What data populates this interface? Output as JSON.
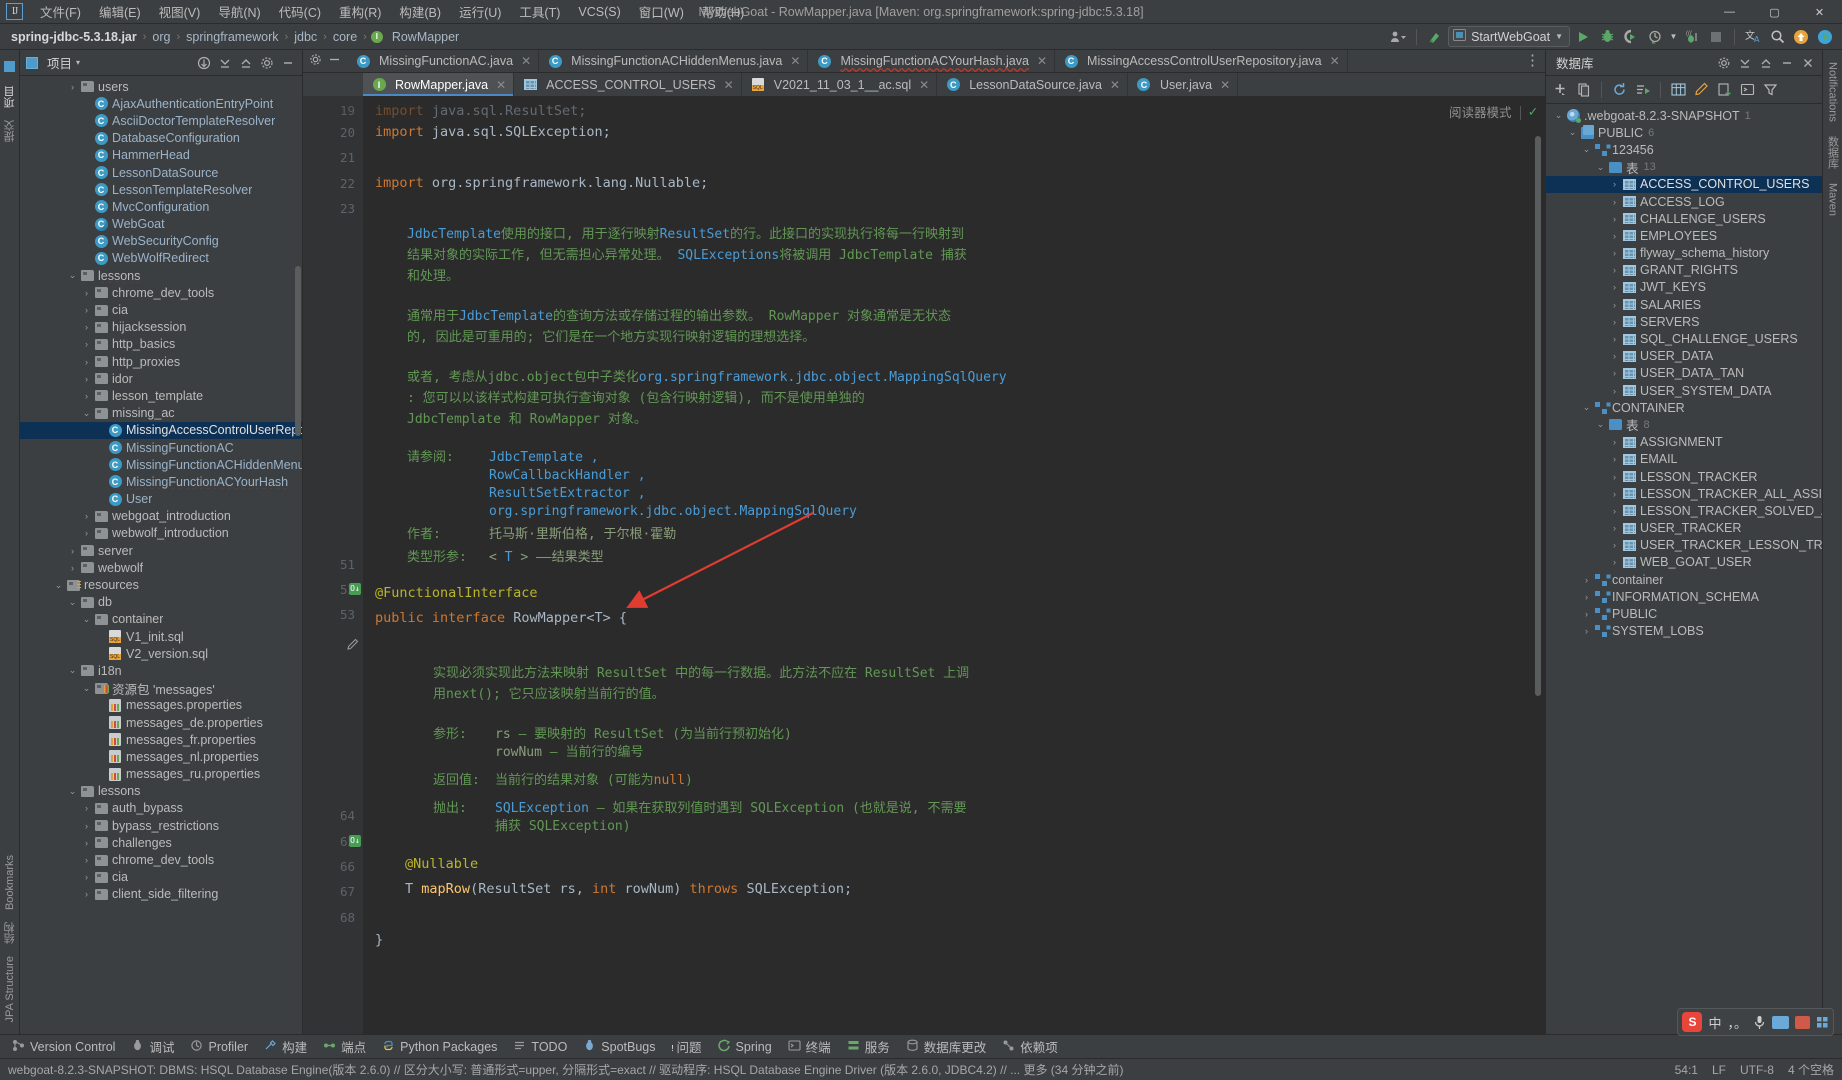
{
  "window": {
    "title": "MyWebGoat - RowMapper.java [Maven: org.springframework:spring-jdbc:5.3.18]",
    "minimize": "—",
    "maximize": "▢",
    "close": "✕"
  },
  "menu": {
    "items": [
      {
        "label": "文件(F)"
      },
      {
        "label": "编辑(E)"
      },
      {
        "label": "视图(V)"
      },
      {
        "label": "导航(N)"
      },
      {
        "label": "代码(C)"
      },
      {
        "label": "重构(R)"
      },
      {
        "label": "构建(B)"
      },
      {
        "label": "运行(U)"
      },
      {
        "label": "工具(T)"
      },
      {
        "label": "VCS(S)"
      },
      {
        "label": "窗口(W)"
      },
      {
        "label": "帮助(H)"
      }
    ]
  },
  "navbar": {
    "breadcrumbs": [
      {
        "label": "spring-jdbc-5.3.18.jar"
      },
      {
        "label": "org"
      },
      {
        "label": "springframework"
      },
      {
        "label": "jdbc"
      },
      {
        "label": "core"
      },
      {
        "label": "RowMapper"
      }
    ],
    "separator": "›",
    "run_config": "StartWebGoat",
    "icons": {
      "user": "user-dropdown-icon",
      "update": "update-project-icon",
      "run": "run-icon",
      "debug": "debug-icon",
      "run_coverage": "run-with-coverage-icon",
      "profile": "profiler-icon",
      "build": "build-icon",
      "stop": "stop-icon",
      "translate": "translate-icon",
      "search": "search-everywhere-icon",
      "updates": "updates-badge-icon",
      "play_badge": "play-badge-icon"
    }
  },
  "left_strip": {
    "tabs": [
      {
        "label": "项目"
      },
      {
        "label": "提交"
      },
      {
        "label": "结构"
      },
      {
        "label": "Bookmarks"
      },
      {
        "label": "JPA Structure"
      }
    ]
  },
  "right_strip": {
    "tabs": [
      {
        "label": "Notifications"
      },
      {
        "label": "数据库"
      },
      {
        "label": "Maven"
      }
    ]
  },
  "project_panel": {
    "title": "项目",
    "dropdown": "▾",
    "actions": [
      "collapse-all-icon",
      "expand-all-icon",
      "select-opened-file-icon",
      "settings-icon",
      "hide-icon"
    ],
    "tree": [
      {
        "depth": 3,
        "arrow": "›",
        "icon": "folder",
        "label": "users",
        "type": "folder"
      },
      {
        "depth": 4,
        "arrow": "",
        "icon": "class",
        "label": "AjaxAuthenticationEntryPoint",
        "type": "class"
      },
      {
        "depth": 4,
        "arrow": "",
        "icon": "class",
        "label": "AsciiDoctorTemplateResolver",
        "type": "class"
      },
      {
        "depth": 4,
        "arrow": "",
        "icon": "class",
        "label": "DatabaseConfiguration",
        "type": "class"
      },
      {
        "depth": 4,
        "arrow": "",
        "icon": "class",
        "label": "HammerHead",
        "type": "class"
      },
      {
        "depth": 4,
        "arrow": "",
        "icon": "class",
        "label": "LessonDataSource",
        "type": "class"
      },
      {
        "depth": 4,
        "arrow": "",
        "icon": "class",
        "label": "LessonTemplateResolver",
        "type": "class"
      },
      {
        "depth": 4,
        "arrow": "",
        "icon": "class",
        "label": "MvcConfiguration",
        "type": "class"
      },
      {
        "depth": 4,
        "arrow": "",
        "icon": "class-spring",
        "label": "WebGoat",
        "type": "class"
      },
      {
        "depth": 4,
        "arrow": "",
        "icon": "class",
        "label": "WebSecurityConfig",
        "type": "class"
      },
      {
        "depth": 4,
        "arrow": "",
        "icon": "class",
        "label": "WebWolfRedirect",
        "type": "class"
      },
      {
        "depth": 3,
        "arrow": "⌄",
        "icon": "folder",
        "label": "lessons",
        "type": "folder",
        "squiggle": true
      },
      {
        "depth": 4,
        "arrow": "›",
        "icon": "folder",
        "label": "chrome_dev_tools",
        "type": "folder"
      },
      {
        "depth": 4,
        "arrow": "›",
        "icon": "folder",
        "label": "cia",
        "type": "folder"
      },
      {
        "depth": 4,
        "arrow": "›",
        "icon": "folder",
        "label": "hijacksession",
        "type": "folder"
      },
      {
        "depth": 4,
        "arrow": "›",
        "icon": "folder",
        "label": "http_basics",
        "type": "folder"
      },
      {
        "depth": 4,
        "arrow": "›",
        "icon": "folder",
        "label": "http_proxies",
        "type": "folder"
      },
      {
        "depth": 4,
        "arrow": "›",
        "icon": "folder",
        "label": "idor",
        "type": "folder"
      },
      {
        "depth": 4,
        "arrow": "›",
        "icon": "folder",
        "label": "lesson_template",
        "type": "folder"
      },
      {
        "depth": 4,
        "arrow": "⌄",
        "icon": "folder",
        "label": "missing_ac",
        "type": "folder",
        "squiggle": true
      },
      {
        "depth": 5,
        "arrow": "",
        "icon": "class",
        "label": "MissingAccessControlUserRepository",
        "type": "class",
        "selected": true
      },
      {
        "depth": 5,
        "arrow": "",
        "icon": "class",
        "label": "MissingFunctionAC",
        "type": "class"
      },
      {
        "depth": 5,
        "arrow": "",
        "icon": "class",
        "label": "MissingFunctionACHiddenMenus",
        "type": "class"
      },
      {
        "depth": 5,
        "arrow": "",
        "icon": "class",
        "label": "MissingFunctionACYourHash",
        "type": "class",
        "squiggle": true
      },
      {
        "depth": 5,
        "arrow": "",
        "icon": "class",
        "label": "User",
        "type": "class"
      },
      {
        "depth": 4,
        "arrow": "›",
        "icon": "folder",
        "label": "webgoat_introduction",
        "type": "folder"
      },
      {
        "depth": 4,
        "arrow": "›",
        "icon": "folder",
        "label": "webwolf_introduction",
        "type": "folder"
      },
      {
        "depth": 3,
        "arrow": "›",
        "icon": "folder",
        "label": "server",
        "type": "folder"
      },
      {
        "depth": 3,
        "arrow": "›",
        "icon": "folder",
        "label": "webwolf",
        "type": "folder"
      },
      {
        "depth": 2,
        "arrow": "⌄",
        "icon": "folder-res",
        "label": "resources",
        "type": "folder"
      },
      {
        "depth": 3,
        "arrow": "⌄",
        "icon": "folder",
        "label": "db",
        "type": "folder"
      },
      {
        "depth": 4,
        "arrow": "⌄",
        "icon": "folder",
        "label": "container",
        "type": "folder"
      },
      {
        "depth": 5,
        "arrow": "",
        "icon": "sql",
        "label": "V1_init.sql",
        "type": "file"
      },
      {
        "depth": 5,
        "arrow": "",
        "icon": "sql",
        "label": "V2_version.sql",
        "type": "file"
      },
      {
        "depth": 3,
        "arrow": "⌄",
        "icon": "folder",
        "label": "i18n",
        "type": "folder"
      },
      {
        "depth": 4,
        "arrow": "⌄",
        "icon": "folder-bundle",
        "label": "资源包 'messages'",
        "type": "folder"
      },
      {
        "depth": 5,
        "arrow": "",
        "icon": "properties",
        "label": "messages.properties",
        "type": "file"
      },
      {
        "depth": 5,
        "arrow": "",
        "icon": "properties",
        "label": "messages_de.properties",
        "type": "file"
      },
      {
        "depth": 5,
        "arrow": "",
        "icon": "properties",
        "label": "messages_fr.properties",
        "type": "file"
      },
      {
        "depth": 5,
        "arrow": "",
        "icon": "properties",
        "label": "messages_nl.properties",
        "type": "file"
      },
      {
        "depth": 5,
        "arrow": "",
        "icon": "properties",
        "label": "messages_ru.properties",
        "type": "file"
      },
      {
        "depth": 3,
        "arrow": "⌄",
        "icon": "folder",
        "label": "lessons",
        "type": "folder"
      },
      {
        "depth": 4,
        "arrow": "›",
        "icon": "folder",
        "label": "auth_bypass",
        "type": "folder"
      },
      {
        "depth": 4,
        "arrow": "›",
        "icon": "folder",
        "label": "bypass_restrictions",
        "type": "folder"
      },
      {
        "depth": 4,
        "arrow": "›",
        "icon": "folder",
        "label": "challenges",
        "type": "folder"
      },
      {
        "depth": 4,
        "arrow": "›",
        "icon": "folder",
        "label": "chrome_dev_tools",
        "type": "folder"
      },
      {
        "depth": 4,
        "arrow": "›",
        "icon": "folder",
        "label": "cia",
        "type": "folder"
      },
      {
        "depth": 4,
        "arrow": "›",
        "icon": "folder",
        "label": "client_side_filtering",
        "type": "folder"
      }
    ]
  },
  "editor": {
    "tabs_row1": [
      {
        "label": "MissingFunctionAC.java",
        "icon": "java-class-icon",
        "active": false
      },
      {
        "label": "MissingFunctionACHiddenMenus.java",
        "icon": "java-class-icon",
        "active": false
      },
      {
        "label": "MissingFunctionACYourHash.java",
        "icon": "java-class-icon",
        "active": false,
        "error": true
      },
      {
        "label": "MissingAccessControlUserRepository.java",
        "icon": "java-class-icon",
        "active": false
      }
    ],
    "tabs_row2": [
      {
        "label": "RowMapper.java",
        "icon": "interface-icon",
        "active": true
      },
      {
        "label": "ACCESS_CONTROL_USERS",
        "icon": "table-icon",
        "active": false
      },
      {
        "label": "V2021_11_03_1__ac.sql",
        "icon": "sql-icon",
        "active": false
      },
      {
        "label": "LessonDataSource.java",
        "icon": "java-class-icon",
        "active": false
      },
      {
        "label": "User.java",
        "icon": "java-class-icon",
        "active": false
      }
    ],
    "reader_mode": "阅读器模式",
    "reader_check": "✓",
    "lines": [
      {
        "num": "19",
        "kind": "code",
        "html": "<span class=\"kw\">import</span> java.sql.ResultSet;",
        "faded": true
      },
      {
        "num": "20",
        "kind": "code",
        "html": "<span class=\"kw\">import</span> java.sql.SQLException;"
      },
      {
        "num": "21",
        "kind": "blank",
        "html": ""
      },
      {
        "num": "22",
        "kind": "code",
        "html": "<span class=\"kw\">import</span> org.springframework.lang.<span style=\"color:#b5b6e3\">Nullable</span>;"
      },
      {
        "num": "23",
        "kind": "blank",
        "html": ""
      }
    ],
    "javadoc": {
      "p1_pre": "JdbcTemplate",
      "p1_mid": "使用的接口, 用于逐行映射",
      "p1_link2": "ResultSet",
      "p1_tail": "的行。此接口的实现执行将每一行映射到",
      "p2": "结果对象的实际工作, 但无需担心异常处理。 ",
      "p2_link": "SQLExceptions",
      "p2_tail": "将被调用 JdbcTemplate 捕获",
      "p3": "和处理。",
      "p4_a": "通常用于",
      "p4_link": "JdbcTemplate",
      "p4_b": "的查询方法或存储过程的输出参数。 RowMapper 对象通常是无状态",
      "p5": "的, 因此是可重用的; 它们是在一个地方实现行映射逻辑的理想选择。",
      "p6_a": "或者, 考虑从jdbc.object包中子类化",
      "p6_link": "org.springframework.jdbc.object.MappingSqlQuery",
      "p7": ": 您可以以该样式构建可执行查询对象 (包含行映射逻辑), 而不是使用单独的",
      "p8": "JdbcTemplate 和 RowMapper 对象。",
      "see_label": "请参阅:",
      "see_items": [
        "JdbcTemplate ,",
        "RowCallbackHandler ,",
        "ResultSetExtractor ,",
        "org.springframework.jdbc.object.MappingSqlQuery"
      ],
      "author_label": "作者:",
      "author_value": "托马斯·里斯伯格, 于尔根·霍勒",
      "typeparam_label": "类型形参:",
      "typeparam_value_pre": "<",
      "typeparam_value_t": "T",
      "typeparam_value_post": "> ——结果类型"
    },
    "code2": {
      "l51_num": "51",
      "l51": "@FunctionalInterface",
      "l52_num": "52",
      "l52_kw1": "public",
      "l52_kw2": "interface",
      "l52_name": "RowMapper",
      "l52_gen": "<T> {",
      "l53_num": "53"
    },
    "javadoc2": {
      "p1": "实现必须实现此方法来映射 ResultSet 中的每一行数据。此方法不应在 ResultSet 上调",
      "p2_a": "用",
      "p2_next": "next()",
      "p2_b": "; 它只应该映射当前行的值。",
      "params_label": "参形:",
      "param1_name": "rs",
      "param1_desc": "– 要映射的 ResultSet (为当前行预初始化)",
      "param2_name": "rowNum",
      "param2_desc": "– 当前行的编号",
      "returns_label": "返回值:",
      "returns_desc_a": "当前行的结果对象 (可能为",
      "returns_null": "null",
      "returns_desc_b": ")",
      "throws_label": "抛出:",
      "throws_type": "SQLException",
      "throws_desc": "– 如果在获取列值时遇到 SQLException (也就是说, 不需要",
      "throws_desc2": "捕获 SQLException)"
    },
    "code3": {
      "l64_num": "64",
      "l64": "@Nullable",
      "l65_num": "65",
      "l65_t": "T",
      "l65_m": "mapRow",
      "l65_p1": "(ResultSet rs, ",
      "l65_kw": "int",
      "l65_p2": " rowNum) ",
      "l65_throws": "throws",
      "l65_ex": " SQLException;",
      "l66_num": "66",
      "l67_num": "67",
      "l67": "}",
      "l68_num": "68"
    }
  },
  "db_panel": {
    "title": "数据库",
    "toolbar": [
      "add-icon",
      "copy-icon",
      "refresh-icon",
      "run-sql-icon",
      "table-icon",
      "edit-icon",
      "new-query-icon",
      "console-icon",
      "filter-icon",
      "settings-icon",
      "collapse-icon",
      "expand-icon",
      "minimize-icon",
      "close-icon"
    ],
    "tree": [
      {
        "depth": 0,
        "arrow": "⌄",
        "icon": "db",
        "label": ".webgoat-8.2.3-SNAPSHOT",
        "badge": "1"
      },
      {
        "depth": 1,
        "arrow": "⌄",
        "icon": "pub",
        "label": "PUBLIC",
        "badge": "6"
      },
      {
        "depth": 2,
        "arrow": "⌄",
        "icon": "schema",
        "label": "123456",
        "badge": ""
      },
      {
        "depth": 3,
        "arrow": "⌄",
        "icon": "fold",
        "label": "表",
        "badge": "13"
      },
      {
        "depth": 4,
        "arrow": "›",
        "icon": "table",
        "label": "ACCESS_CONTROL_USERS",
        "selected": true
      },
      {
        "depth": 4,
        "arrow": "›",
        "icon": "table",
        "label": "ACCESS_LOG"
      },
      {
        "depth": 4,
        "arrow": "›",
        "icon": "table",
        "label": "CHALLENGE_USERS"
      },
      {
        "depth": 4,
        "arrow": "›",
        "icon": "table",
        "label": "EMPLOYEES"
      },
      {
        "depth": 4,
        "arrow": "›",
        "icon": "table",
        "label": "flyway_schema_history"
      },
      {
        "depth": 4,
        "arrow": "›",
        "icon": "table",
        "label": "GRANT_RIGHTS"
      },
      {
        "depth": 4,
        "arrow": "›",
        "icon": "table",
        "label": "JWT_KEYS"
      },
      {
        "depth": 4,
        "arrow": "›",
        "icon": "table",
        "label": "SALARIES"
      },
      {
        "depth": 4,
        "arrow": "›",
        "icon": "table",
        "label": "SERVERS"
      },
      {
        "depth": 4,
        "arrow": "›",
        "icon": "table",
        "label": "SQL_CHALLENGE_USERS"
      },
      {
        "depth": 4,
        "arrow": "›",
        "icon": "table",
        "label": "USER_DATA"
      },
      {
        "depth": 4,
        "arrow": "›",
        "icon": "table",
        "label": "USER_DATA_TAN"
      },
      {
        "depth": 4,
        "arrow": "›",
        "icon": "table",
        "label": "USER_SYSTEM_DATA"
      },
      {
        "depth": 2,
        "arrow": "⌄",
        "icon": "schema",
        "label": "CONTAINER",
        "badge": ""
      },
      {
        "depth": 3,
        "arrow": "⌄",
        "icon": "fold",
        "label": "表",
        "badge": "8"
      },
      {
        "depth": 4,
        "arrow": "›",
        "icon": "table",
        "label": "ASSIGNMENT"
      },
      {
        "depth": 4,
        "arrow": "›",
        "icon": "table",
        "label": "EMAIL"
      },
      {
        "depth": 4,
        "arrow": "›",
        "icon": "table",
        "label": "LESSON_TRACKER"
      },
      {
        "depth": 4,
        "arrow": "›",
        "icon": "table",
        "label": "LESSON_TRACKER_ALL_ASSIGNMENTS"
      },
      {
        "depth": 4,
        "arrow": "›",
        "icon": "table",
        "label": "LESSON_TRACKER_SOLVED_ASSIGNMENTS"
      },
      {
        "depth": 4,
        "arrow": "›",
        "icon": "table",
        "label": "USER_TRACKER"
      },
      {
        "depth": 4,
        "arrow": "›",
        "icon": "table",
        "label": "USER_TRACKER_LESSON_TRACKERS"
      },
      {
        "depth": 4,
        "arrow": "›",
        "icon": "table",
        "label": "WEB_GOAT_USER"
      },
      {
        "depth": 2,
        "arrow": "›",
        "icon": "schema",
        "label": "container",
        "badge": ""
      },
      {
        "depth": 2,
        "arrow": "›",
        "icon": "schema",
        "label": "INFORMATION_SCHEMA",
        "badge": ""
      },
      {
        "depth": 2,
        "arrow": "›",
        "icon": "schema",
        "label": "PUBLIC",
        "badge": ""
      },
      {
        "depth": 2,
        "arrow": "›",
        "icon": "schema",
        "label": "SYSTEM_LOBS",
        "badge": ""
      }
    ]
  },
  "bottom_bar": {
    "items": [
      {
        "label": "Version Control",
        "icon": "vcs-icon"
      },
      {
        "label": "调试",
        "icon": "debug-icon"
      },
      {
        "label": "Profiler",
        "icon": "profiler-icon"
      },
      {
        "label": "构建",
        "icon": "build-icon"
      },
      {
        "label": "端点",
        "icon": "endpoints-icon"
      },
      {
        "label": "Python Packages",
        "icon": "python-icon"
      },
      {
        "label": "TODO",
        "icon": "todo-icon"
      },
      {
        "label": "SpotBugs",
        "icon": "spotbugs-icon"
      },
      {
        "label": "问题",
        "icon": "problems-icon"
      },
      {
        "label": "Spring",
        "icon": "spring-icon"
      },
      {
        "label": "终端",
        "icon": "terminal-icon"
      },
      {
        "label": "服务",
        "icon": "services-icon"
      },
      {
        "label": "数据库更改",
        "icon": "db-changes-icon"
      },
      {
        "label": "依赖项",
        "icon": "dependencies-icon"
      }
    ]
  },
  "status_bar": {
    "message": "webgoat-8.2.3-SNAPSHOT: DBMS: HSQL Database Engine(版本 2.6.0) // 区分大小写: 普通形式=upper, 分隔形式=exact // 驱动程序: HSQL Database Engine Driver (版本 2.6.0, JDBC4.2) // ... 更多 (34 分钟之前)",
    "caret": "54:1",
    "line_sep": "LF",
    "encoding": "UTF-8",
    "indent": "4 个空格"
  },
  "ime": {
    "logo": "S",
    "mode": "中",
    "punct": "，。",
    "mic": "mic-icon",
    "keyboard": "keyboard-icon",
    "tools": "tools-icon",
    "menu": "menu-icon"
  }
}
